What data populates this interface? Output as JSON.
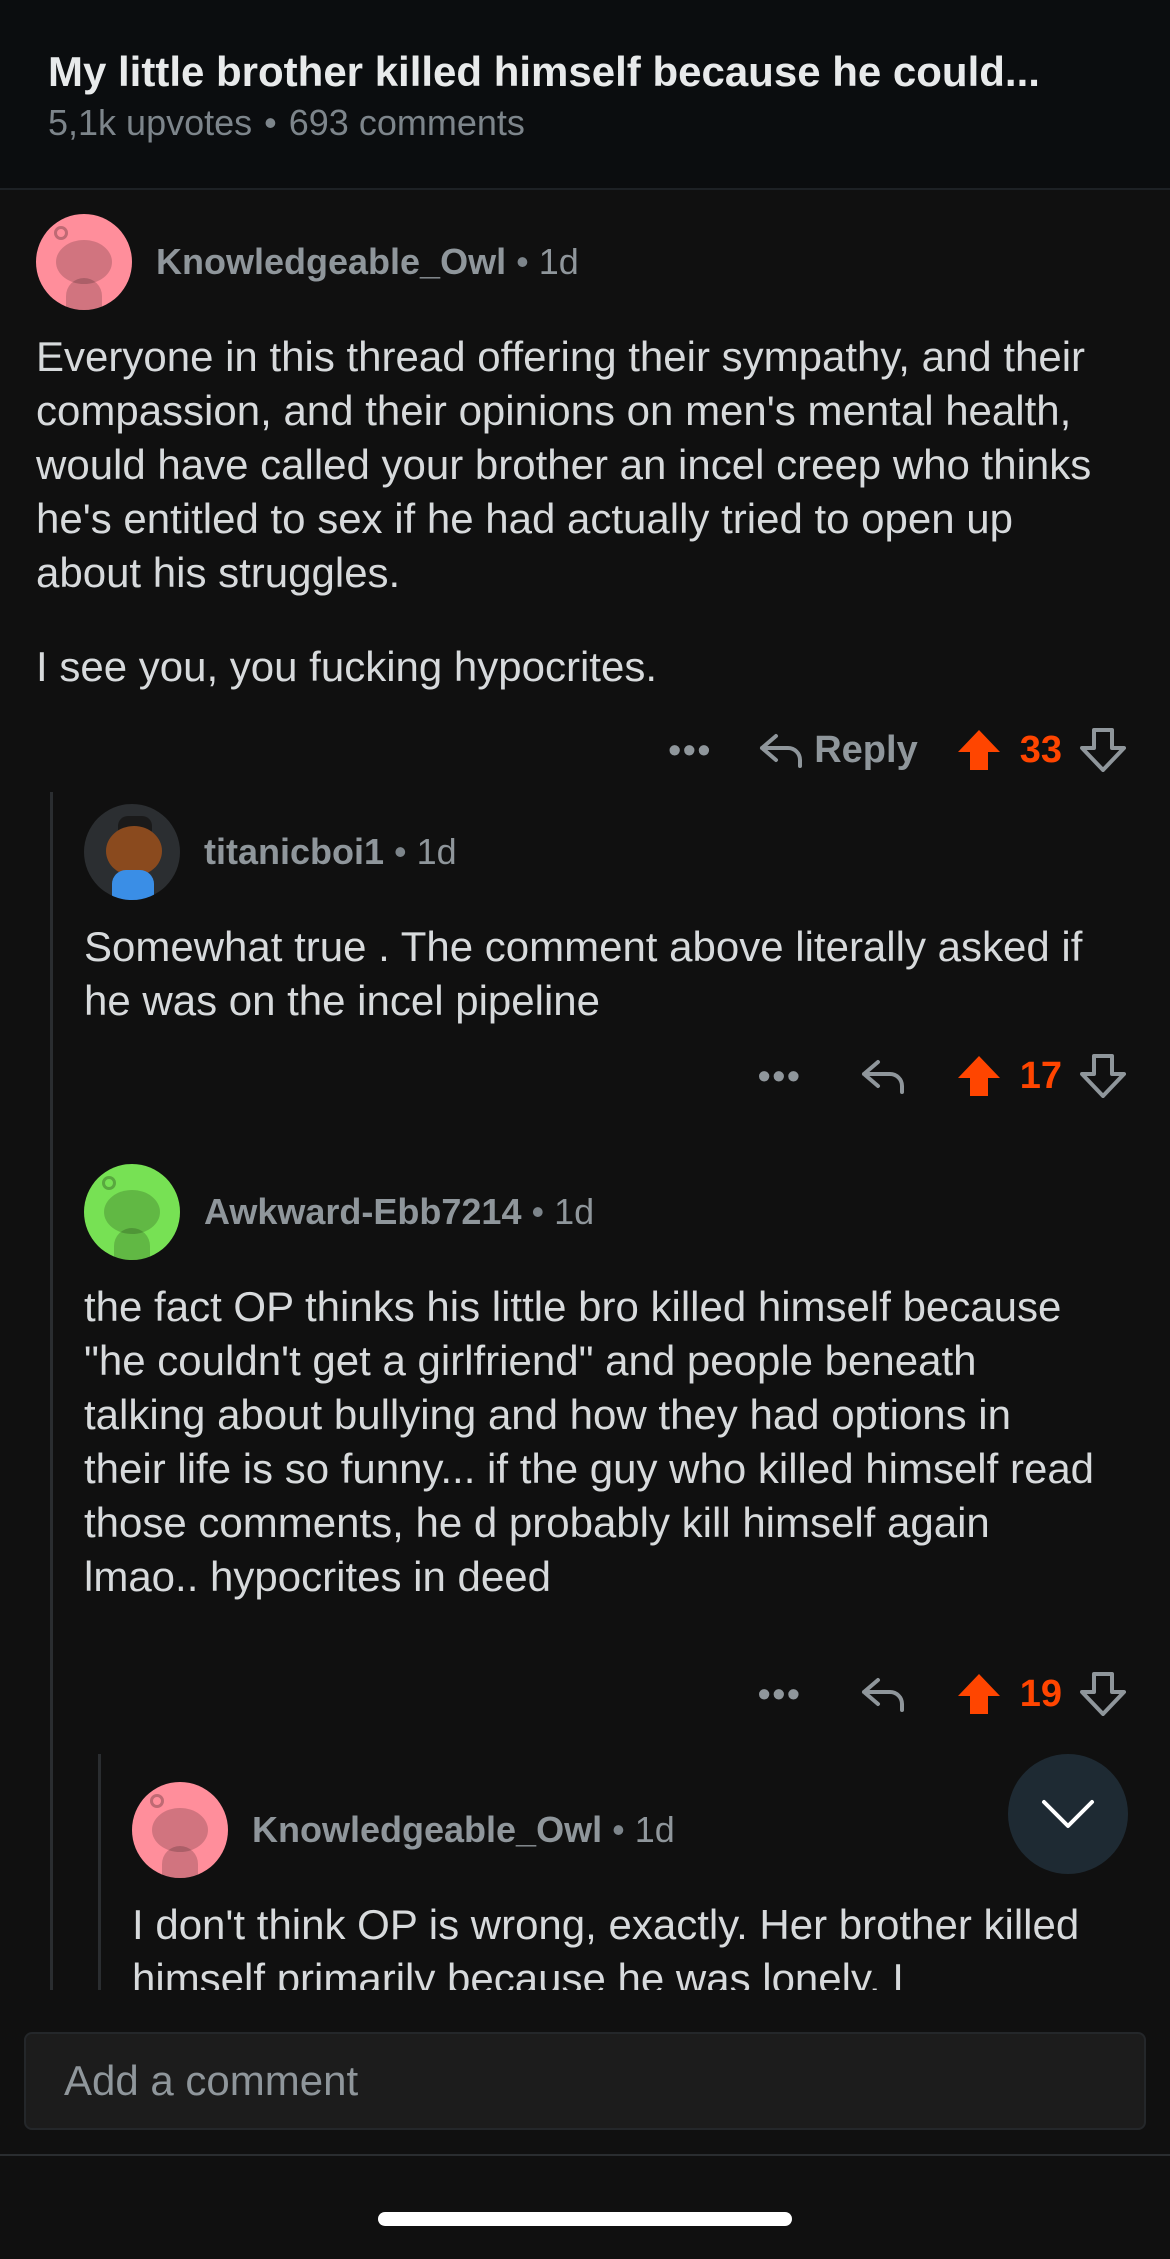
{
  "post": {
    "title": "My little brother killed himself because he could...",
    "upvotes": "5,1k upvotes",
    "comments": "693 comments"
  },
  "comments": [
    {
      "username": "Knowledgeable_Owl",
      "age": "1d",
      "paragraphs": [
        "Everyone in this thread offering their sympathy, and their compassion, and their opinions on men's mental health, would have called your brother an incel creep who thinks he's entitled to sex if he had actually tried to open up about his struggles.",
        "I see you, you fucking hypocrites."
      ],
      "reply_label": "Reply",
      "score": "33"
    },
    {
      "username": "titanicboi1",
      "age": "1d",
      "paragraphs": [
        "Somewhat true . The comment above literally asked if he was on the incel pipeline"
      ],
      "score": "17"
    },
    {
      "username": "Awkward-Ebb7214",
      "age": "1d",
      "paragraphs": [
        "the fact OP thinks his little bro killed himself because \"he couldn't get a girlfriend\" and people beneath talking about bullying and how they had options in their life is so funny... if the guy who killed himself read those comments, he d probably kill himself again lmao.. hypocrites in deed"
      ],
      "score": "19"
    },
    {
      "username": "Knowledgeable_Owl",
      "age": "1d",
      "paragraphs": [
        "I don't think OP is wrong, exactly. Her brother killed himself primarily because he was lonely. I"
      ]
    }
  ],
  "more_label": "•••",
  "separator": "•",
  "add_comment_placeholder": "Add a comment",
  "colors": {
    "accent": "#ff4500",
    "background": "#101010",
    "text": "#d7dadc",
    "muted": "#8f969b"
  },
  "icons": [
    "more-icon",
    "reply-icon",
    "upvote-icon",
    "downvote-icon",
    "chevron-down-icon",
    "snoo-avatar-icon"
  ]
}
